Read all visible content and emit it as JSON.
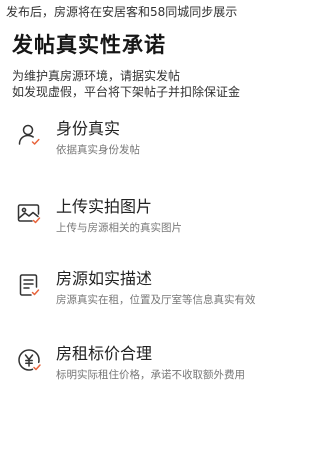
{
  "notice": "发布后，房源将在安居客和58同城同步展示",
  "title": "发帖真实性承诺",
  "description": [
    "为维护真房源环境，请据实发帖",
    "如发现虚假，平台将下架帖子并扣除保证金"
  ],
  "items": [
    {
      "icon": "person-check-icon",
      "title": "身份真实",
      "subtitle": "依据真实身份发帖"
    },
    {
      "icon": "image-check-icon",
      "title": "上传实拍图片",
      "subtitle": "上传与房源相关的真实图片"
    },
    {
      "icon": "document-check-icon",
      "title": "房源如实描述",
      "subtitle": "房源真实在租，位置及厅室等信息真实有效"
    },
    {
      "icon": "yen-check-icon",
      "title": "房租标价合理",
      "subtitle": "标明实际租住价格，承诺不收取额外费用"
    }
  ],
  "colors": {
    "icon_stroke": "#333333",
    "check_accent": "#e8643c"
  }
}
